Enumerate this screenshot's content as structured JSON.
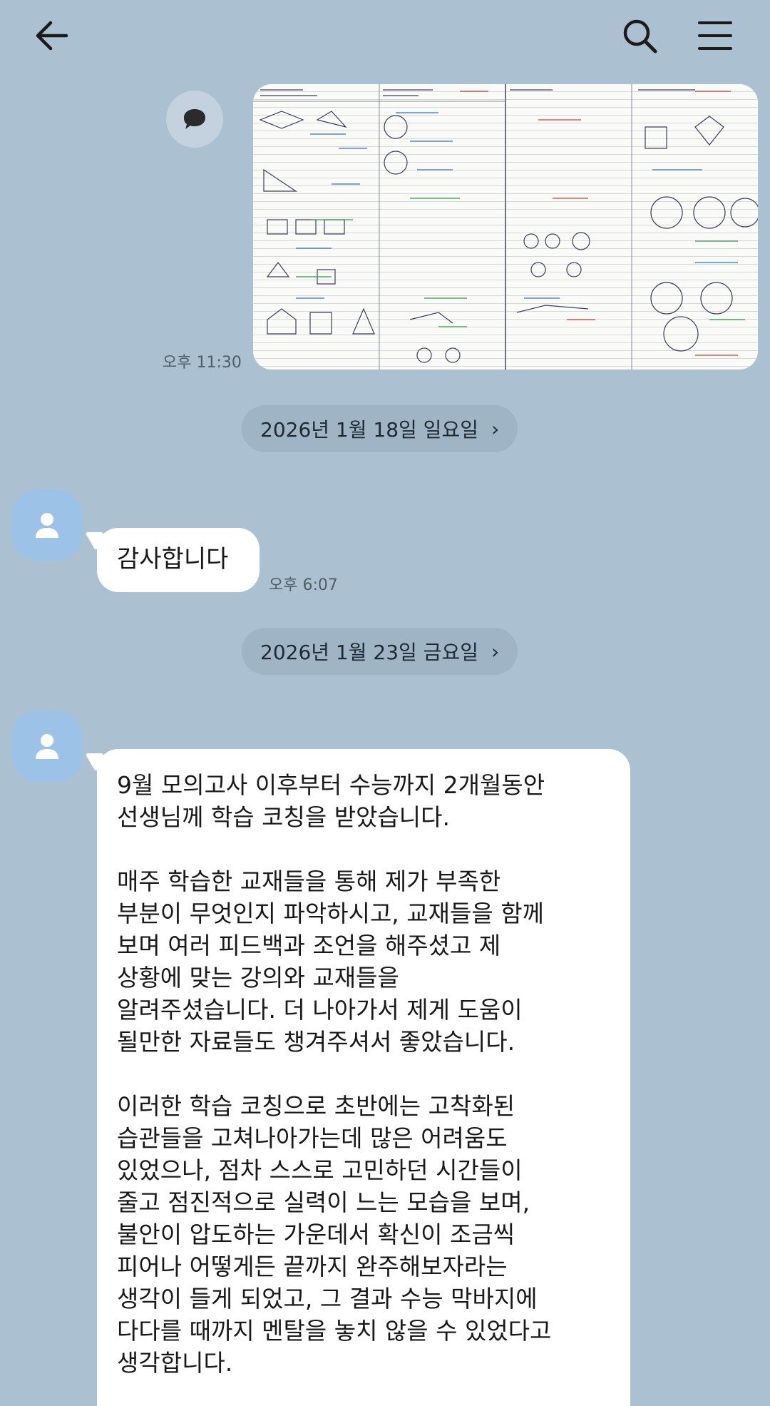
{
  "topbar": {
    "back_icon": "arrow-left-icon",
    "search_icon": "search-icon",
    "menu_icon": "hamburger-menu-icon"
  },
  "messages": [
    {
      "kind": "image",
      "time": "오후 11:30",
      "share_icon": "speech-bubble-icon",
      "image_description_icon": "photo-of-handwritten-math-notes"
    },
    {
      "kind": "date_divider",
      "label": "2026년 1월 18일 일요일"
    },
    {
      "kind": "text",
      "text": "감사합니다",
      "time": "오후 6:07"
    },
    {
      "kind": "date_divider",
      "label": "2026년 1월 23일 금요일"
    },
    {
      "kind": "text",
      "paragraphs": [
        "9월 모의고사 이후부터 수능까지 2개월동안\n선생님께 학습 코칭을 받았습니다.",
        "매주 학습한 교재들을 통해 제가 부족한\n부분이 무엇인지 파악하시고, 교재들을 함께\n보며 여러 피드백과 조언을 해주셨고 제\n상황에 맞는 강의와 교재들을\n알려주셨습니다. 더 나아가서 제게 도움이\n될만한 자료들도 챙겨주셔서 좋았습니다.",
        "이러한 학습 코칭으로 초반에는 고착화된\n습관들을 고쳐나아가는데 많은 어려움도\n있었으나, 점차 스스로 고민하던 시간들이\n줄고 점진적으로 실력이 느는 모습을 보며,\n불안이 압도하는 가운데서 확신이 조금씩\n피어나 어떻게든 끝까지 완주해보자라는\n생각이 들게 되었고, 그 결과 수능 막바지에\n다다를 때까지 멘탈을 놓치 않을 수 있었다고\n생각합니다."
      ]
    }
  ],
  "colors": {
    "background": "#abc1d1",
    "bubble": "#ffffff",
    "date_pill": "#9fb4c4",
    "avatar": "#9cc2e7"
  }
}
